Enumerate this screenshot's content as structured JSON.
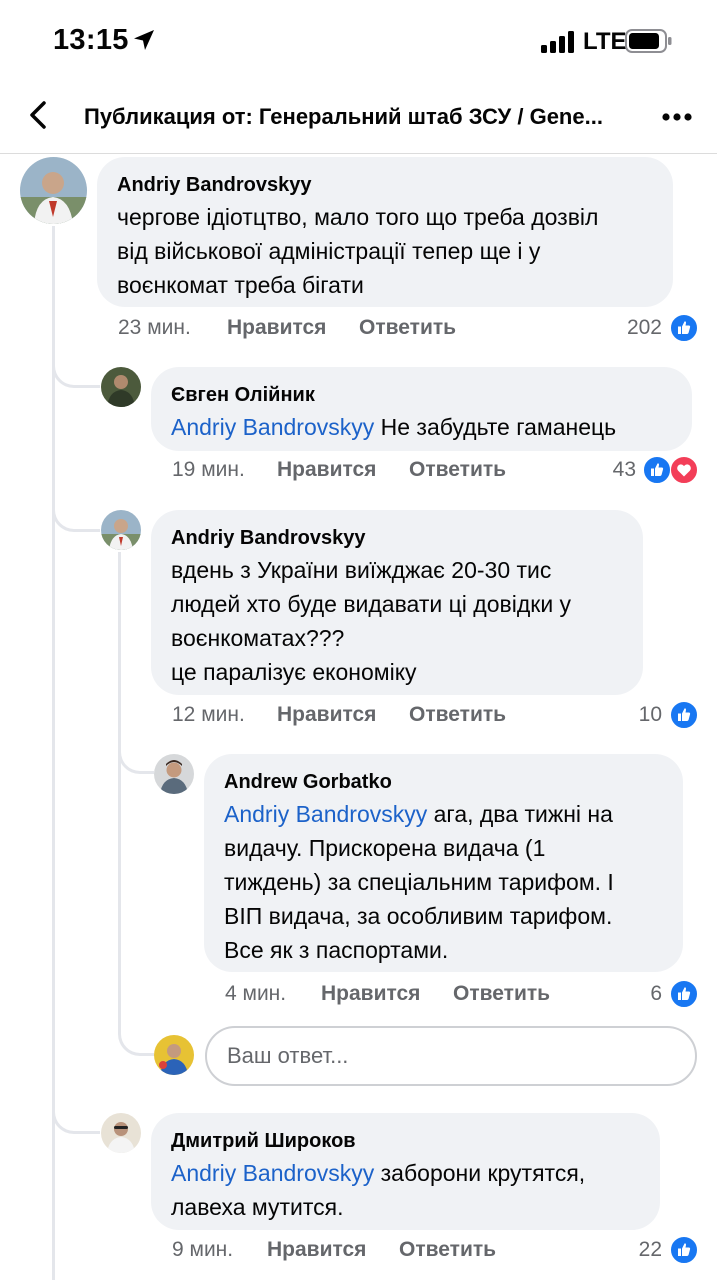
{
  "status_bar": {
    "time": "13:15",
    "network": "LTE"
  },
  "header": {
    "title": "Публикация от: Генеральний штаб ЗСУ / Gene..."
  },
  "actions": {
    "like": "Нравится",
    "reply": "Ответить"
  },
  "comments": [
    {
      "author": "Andriy Bandrovskyy",
      "mention": "",
      "lines": [
        "чергове ідіотцтво, мало того що треба дозвіл",
        "від військової адміністрації тепер ще і у",
        "воєнкомат треба бігати"
      ],
      "time": "23 мин.",
      "reaction_count": "202",
      "reactions": [
        "like"
      ]
    },
    {
      "author": "Євген Олійник",
      "mention": "Andriy Bandrovskyy",
      "lines": [
        "Не забудьте гаманець"
      ],
      "time": "19 мин.",
      "reaction_count": "43",
      "reactions": [
        "like",
        "love"
      ]
    },
    {
      "author": "Andriy Bandrovskyy",
      "mention": "",
      "lines": [
        "вдень з України виїжджає 20-30 тис",
        "людей хто буде видавати ці довідки у",
        "воєнкоматах???",
        "це паралізує економіку"
      ],
      "time": "12 мин.",
      "reaction_count": "10",
      "reactions": [
        "like"
      ]
    },
    {
      "author": "Andrew Gorbatko",
      "mention": "Andriy Bandrovskyy",
      "mention_tail": " ага, два тижні на",
      "lines": [
        "видачу. Прискорена видача (1",
        "тиждень) за спеціальним тарифом. І",
        "ВІП видача, за особливим тарифом.",
        "Все як з паспортами."
      ],
      "time": "4 мин.",
      "reaction_count": "6",
      "reactions": [
        "like"
      ]
    },
    {
      "author": "Дмитрий Широков",
      "mention": "Andriy Bandrovskyy",
      "mention_tail": " заборони крутятся,",
      "lines": [
        "лавеха мутится."
      ],
      "time": "9 мин.",
      "reaction_count": "22",
      "reactions": [
        "like"
      ]
    }
  ],
  "reply_box": {
    "placeholder": "Ваш ответ..."
  },
  "colors": {
    "like_blue": "#1877f2",
    "love_red": "#f33e58",
    "mention": "#1c62c9",
    "bubble": "#f0f2f5"
  },
  "icons": [
    "location-arrow-icon",
    "signal-icon",
    "battery-icon",
    "back-arrow-icon",
    "more-icon",
    "like-reaction-icon",
    "love-reaction-icon"
  ]
}
